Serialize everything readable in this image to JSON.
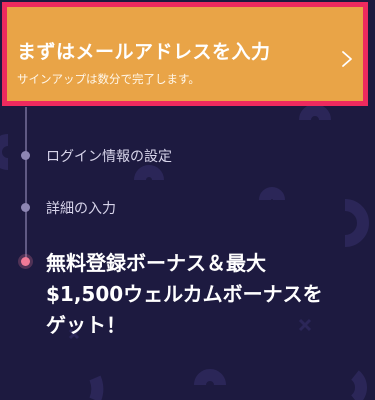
{
  "colors": {
    "background": "#1d1a40",
    "banner_fill": "#e9a447",
    "banner_border": "#ee2a5e",
    "step_inactive": "#8d86b3",
    "step_active": "#f07a97",
    "deco": "#2b2658"
  },
  "banner": {
    "title": "まずはメールアドレスを入力",
    "subtitle": "サインアップは数分で完了します。",
    "chevron_icon": "chevron-right-icon"
  },
  "steps": [
    {
      "label": "ログイン情報の設定",
      "active": false
    },
    {
      "label": "詳細の入力",
      "active": false
    }
  ],
  "final_step": {
    "line1": "無料登録ボーナス＆最大",
    "line2": "$1,500ウェルカムボーナスを",
    "line3": "ゲット！",
    "active": true
  }
}
